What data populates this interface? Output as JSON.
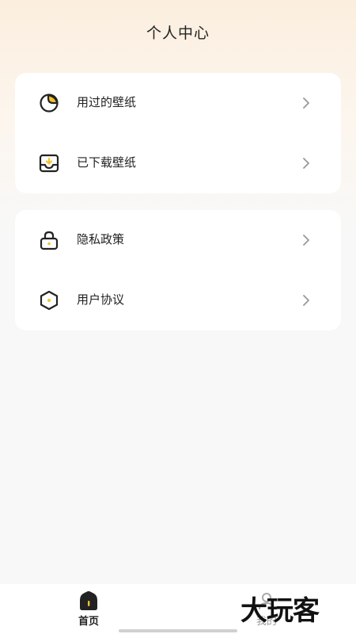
{
  "header": {
    "title": "个人中心"
  },
  "menu": {
    "group1": [
      {
        "label": "用过的壁纸",
        "icon": "sticker-icon"
      },
      {
        "label": "已下载壁纸",
        "icon": "inbox-download-icon"
      }
    ],
    "group2": [
      {
        "label": "隐私政策",
        "icon": "lock-icon"
      },
      {
        "label": "用户协议",
        "icon": "hexagon-icon"
      }
    ]
  },
  "tabbar": {
    "home_label": "首页",
    "mine_label": "我的"
  },
  "watermark": "大玩客",
  "colors": {
    "accent": "#f5c230",
    "background_top": "#fbeede",
    "background": "#f8f8f8",
    "card": "#ffffff",
    "text": "#222222",
    "chevron": "#999999"
  }
}
